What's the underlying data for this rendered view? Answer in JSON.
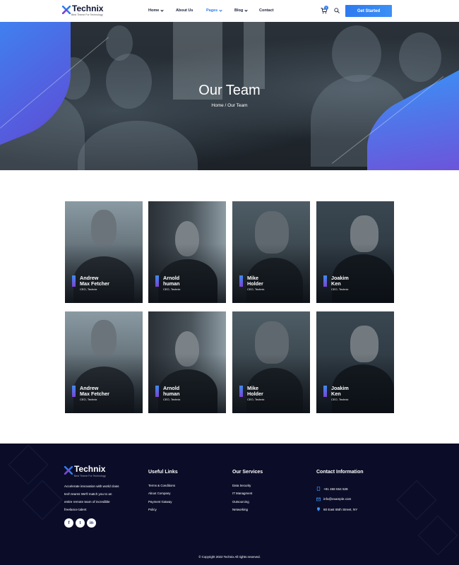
{
  "header": {
    "brand": "Technix",
    "tagline": "Best Theme For Technology",
    "nav": [
      {
        "label": "Home",
        "has_dropdown": true,
        "active": false
      },
      {
        "label": "About Us",
        "has_dropdown": false,
        "active": false
      },
      {
        "label": "Pages",
        "has_dropdown": true,
        "active": true
      },
      {
        "label": "Blog",
        "has_dropdown": true,
        "active": false
      },
      {
        "label": "Contact",
        "has_dropdown": false,
        "active": false
      }
    ],
    "cart_count": "0",
    "cta_label": "Get Started"
  },
  "hero": {
    "title": "Our Team",
    "breadcrumb": "Home / Our Team"
  },
  "team": [
    {
      "name_line1": "Andrew",
      "name_line2": "Max Fetcher",
      "role": "CEO, Technix"
    },
    {
      "name_line1": "Arnold",
      "name_line2": "human",
      "role": "CEO, Technix"
    },
    {
      "name_line1": "Mike",
      "name_line2": "Holder",
      "role": "CEO, Technix"
    },
    {
      "name_line1": "Joakim",
      "name_line2": "Ken",
      "role": "CEO, Technix"
    },
    {
      "name_line1": "Andrew",
      "name_line2": "Max Fetcher",
      "role": "CEO, Technix"
    },
    {
      "name_line1": "Arnold",
      "name_line2": "human",
      "role": "CEO, Technix"
    },
    {
      "name_line1": "Mike",
      "name_line2": "Holder",
      "role": "CEO, Technix"
    },
    {
      "name_line1": "Joakim",
      "name_line2": "Ken",
      "role": "CEO, Technix"
    }
  ],
  "footer": {
    "brand": "Technix",
    "tagline": "Best Theme For Technology",
    "about": "Accelerate innovation with world class tech teams We'll match you to an entire remote team of incredible freelance talent",
    "socials": [
      "f",
      "t",
      "in"
    ],
    "useful_links": {
      "title": "Useful Links",
      "items": [
        "Terms & Conditions",
        "About Company",
        "Payment Gatway",
        "Policy"
      ]
    },
    "services": {
      "title": "Our Services",
      "items": [
        "Data Security",
        "IT Managment",
        "Outsourcing",
        "Networking"
      ]
    },
    "contact": {
      "title": "Contact Information",
      "phone": "+91 458 654 528",
      "email": "info@example.com",
      "address": "60 East 65th Street, NY"
    },
    "copyright": "© Copyright 2022 Technix All rights reserved."
  },
  "colors": {
    "accent": "#2f7bf0",
    "gradient_end": "#7c44d3",
    "footer_bg": "#0b0d28",
    "text_dark": "#1a1f3b"
  }
}
